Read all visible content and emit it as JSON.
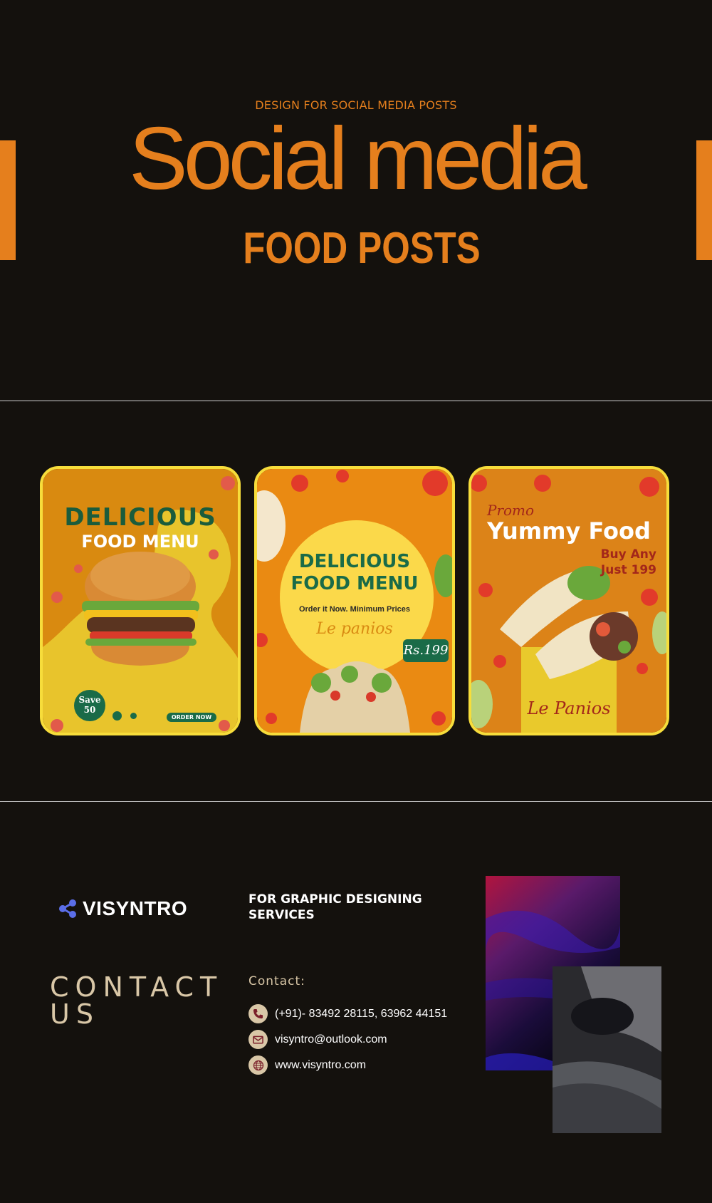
{
  "hero": {
    "eyebrow": "DESIGN FOR SOCIAL MEDIA POSTS",
    "headline": "Social media",
    "subhead": "FOOD POSTS"
  },
  "colors": {
    "accent": "#e57f1d",
    "background": "#14110d",
    "card_border": "#f7dd3b",
    "contact_text": "#d9c7a7",
    "logo_icon": "#5b6ee8"
  },
  "posts": [
    {
      "heading": "DELICIOUS",
      "subheading": "FOOD MENU",
      "badge_line1": "Save",
      "badge_line2": "50",
      "cta": "ORDER NOW"
    },
    {
      "heading": "DELICIOUS",
      "subheading": "FOOD MENU",
      "tagline": "Order it Now. Minimum Prices",
      "brand": "Le panios",
      "price": "Rs.199"
    },
    {
      "eyebrow": "Promo",
      "heading": "Yummy Food",
      "offer_line1": "Buy Any",
      "offer_line2": "Just 199",
      "brand": "Le Panios"
    }
  ],
  "footer": {
    "logo_text": "VISYNTRO",
    "logo_icon": "share-icon",
    "tagline": "FOR GRAPHIC DESIGNING SERVICES",
    "contact_title_line1": "CONTACT",
    "contact_title_line2": "US",
    "contact_label": "Contact:",
    "phone": "(+91)- 83492 28115, 63962 44151",
    "email": "visyntro@outlook.com",
    "website": "www.visyntro.com"
  }
}
